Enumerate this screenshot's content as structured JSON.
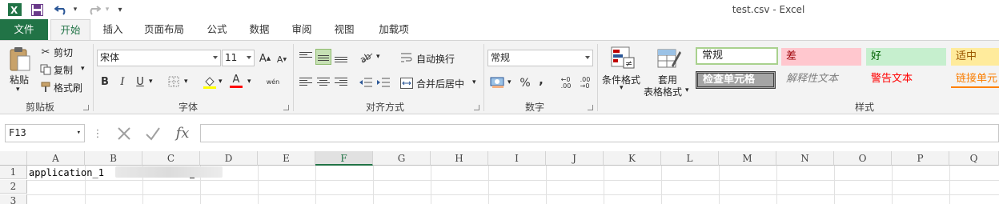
{
  "window": {
    "title": "test.csv - Excel"
  },
  "quick_access": {
    "customize": "▾"
  },
  "tabs": [
    "文件",
    "开始",
    "插入",
    "页面布局",
    "公式",
    "数据",
    "审阅",
    "视图",
    "加载项"
  ],
  "ribbon": {
    "clipboard": {
      "paste": "粘贴",
      "cut": "剪切",
      "copy": "复制",
      "format_painter": "格式刷",
      "label": "剪贴板"
    },
    "font": {
      "name": "宋体",
      "size": "11",
      "bold": "B",
      "italic": "I",
      "underline": "U",
      "font_color": "A",
      "phonetic": "wén",
      "label": "字体"
    },
    "alignment": {
      "wrap": "自动换行",
      "merge": "合并后居中",
      "label": "对齐方式"
    },
    "number": {
      "format": "常规",
      "percent": "%",
      "comma": ",",
      "label": "数字"
    },
    "styles": {
      "conditional": "条件格式",
      "table_format_1": "套用",
      "table_format_2": "表格格式",
      "gallery": [
        "常规",
        "差",
        "好",
        "适中",
        "检查单元格",
        "解释性文本",
        "警告文本",
        "链接单元"
      ],
      "label": "样式"
    }
  },
  "formula_bar": {
    "name_box": "F13",
    "formula": ""
  },
  "grid": {
    "columns": [
      "A",
      "B",
      "C",
      "D",
      "E",
      "F",
      "G",
      "H",
      "I",
      "J",
      "K",
      "L",
      "M",
      "N",
      "O",
      "P",
      "Q"
    ],
    "selected_column": "F",
    "rows": [
      "1",
      "2",
      "3"
    ],
    "cells": {
      "A1": "application_1"
    }
  },
  "colors": {
    "accent": "#217346",
    "bad_bg": "#ffc7ce",
    "good_bg": "#c6efce",
    "neutral_bg": "#ffeb9c"
  }
}
